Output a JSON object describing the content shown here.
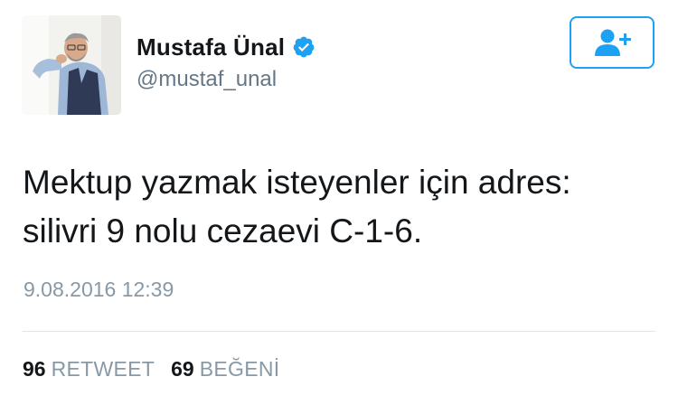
{
  "tweet": {
    "author": {
      "display_name": "Mustafa Ünal",
      "handle": "@mustaf_unal",
      "verified": true,
      "avatar_icon": "profile-photo"
    },
    "follow_button": {
      "icon": "add-user-icon",
      "color": "#1da1f2"
    },
    "text_lines": [
      "Mektup yazmak isteyenler için adres:",
      "silivri 9 nolu cezaevi C-1-6."
    ],
    "timestamp": "9.08.2016 12:39",
    "stats": {
      "retweets_count": "96",
      "retweets_label": "RETWEET",
      "likes_count": "69",
      "likes_label": "BEĞENİ"
    }
  },
  "colors": {
    "accent": "#1da1f2",
    "text": "#14171a",
    "muted": "#8899a6"
  }
}
